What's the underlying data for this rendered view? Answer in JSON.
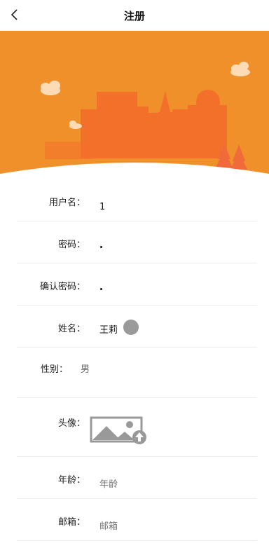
{
  "header": {
    "title": "注册",
    "back_icon": "chevron-left-icon"
  },
  "banner": {
    "background_color": "#F0902A",
    "accent_color": "#F36B2B"
  },
  "form": {
    "username": {
      "label": "用户名：",
      "value": "1"
    },
    "password": {
      "label": "密码：",
      "masked_length": 1
    },
    "confirm_password": {
      "label": "确认密码：",
      "masked_length": 1
    },
    "name": {
      "label": "姓名：",
      "value": "王莉",
      "clear_icon": "clear-circle-icon"
    },
    "gender": {
      "label": "性别：",
      "value": "男"
    },
    "avatar": {
      "label": "头像：",
      "upload_icon": "image-upload-icon"
    },
    "age": {
      "label": "年龄：",
      "placeholder": "年龄"
    },
    "email": {
      "label": "邮箱：",
      "placeholder": "邮箱"
    }
  }
}
